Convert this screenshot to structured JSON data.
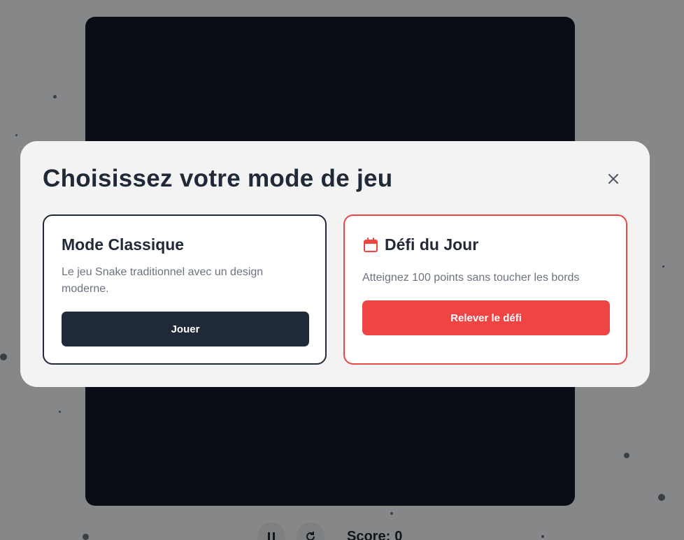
{
  "modal": {
    "title": "Choisissez votre mode de jeu",
    "close_icon": "close-icon"
  },
  "modes": {
    "classic": {
      "title": "Mode Classique",
      "description": "Le jeu Snake traditionnel avec un design moderne.",
      "button_label": "Jouer"
    },
    "daily": {
      "icon": "calendar-icon",
      "title": "Défi du Jour",
      "description": "Atteignez 100 points sans toucher les bords",
      "button_label": "Relever le défi"
    }
  },
  "controls": {
    "pause_icon": "pause-icon",
    "restart_icon": "restart-icon",
    "score_label": "Score:",
    "score_value": "0"
  },
  "colors": {
    "primary_dark": "#1f2937",
    "accent_red": "#ef4444",
    "board": "#111827",
    "modal_bg": "#f3f3f3"
  }
}
